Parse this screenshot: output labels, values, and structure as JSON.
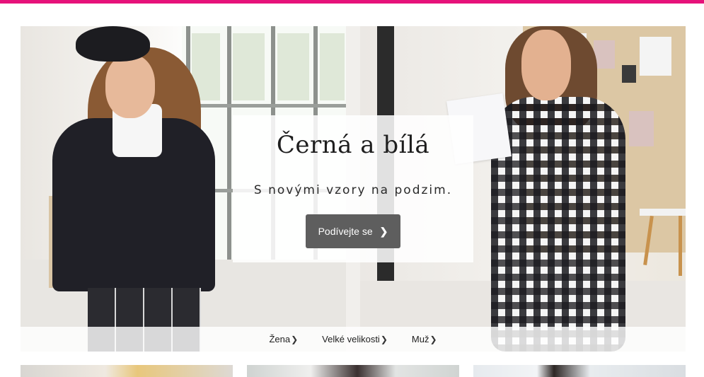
{
  "colors": {
    "brand_accent": "#e6127a",
    "button_bg": "#5e5e5e",
    "button_text": "#ffffff"
  },
  "promo": {
    "title": "Černá a bílá",
    "subtitle": "S novými vzory na podzim.",
    "cta_label": "Podívejte se",
    "cta_icon": "chevron-right-icon"
  },
  "categories": [
    {
      "label": "Žena",
      "icon": "chevron-right-icon"
    },
    {
      "label": "Velké velikosti",
      "icon": "chevron-right-icon"
    },
    {
      "label": "Muž",
      "icon": "chevron-right-icon"
    }
  ]
}
